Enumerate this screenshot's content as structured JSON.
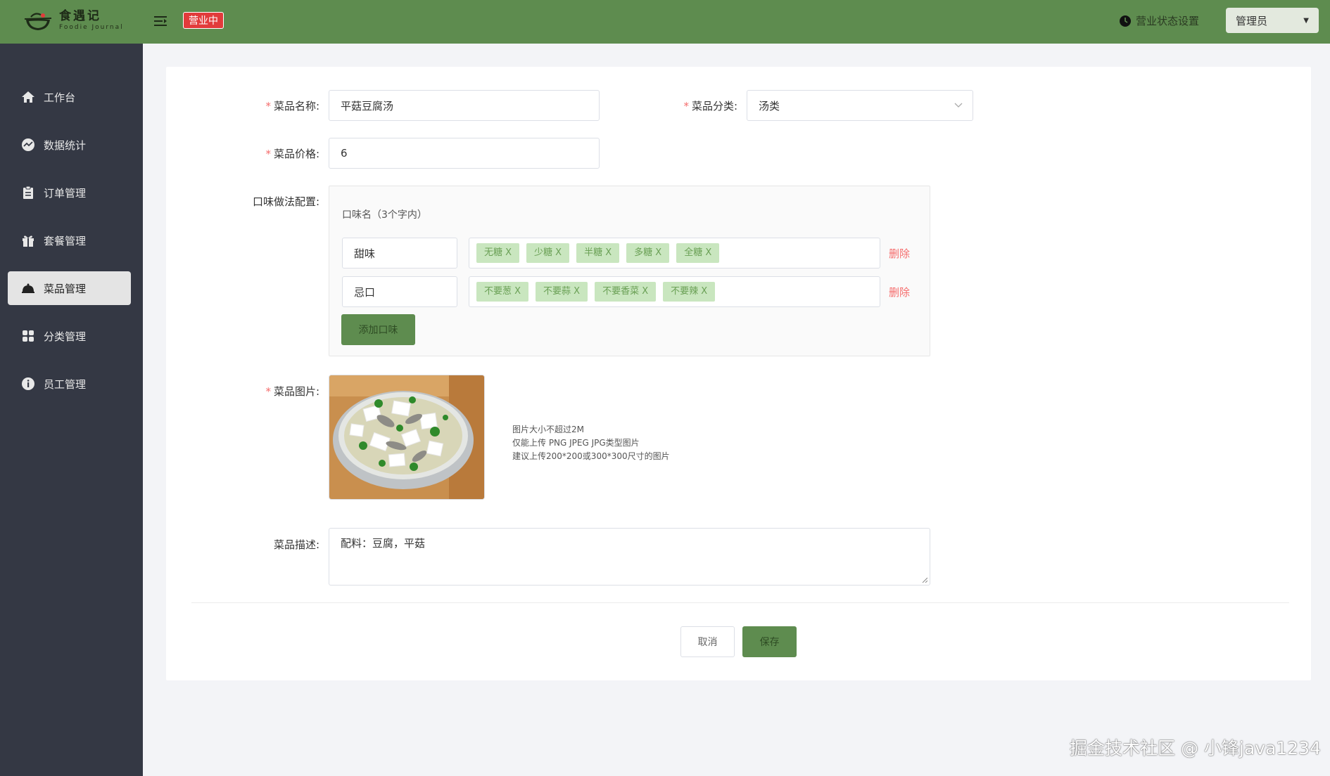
{
  "header": {
    "logo_cn": "食遇记",
    "logo_en": "Foodie Journal",
    "business_badge": "营业中",
    "status_setting": "营业状态设置",
    "admin_label": "管理员",
    "admin_caret": "▼",
    "brand_color": "#5e8c4f"
  },
  "sidebar": {
    "items": [
      {
        "label": "工作台",
        "icon": "home-icon"
      },
      {
        "label": "数据统计",
        "icon": "chart-icon"
      },
      {
        "label": "订单管理",
        "icon": "clipboard-icon"
      },
      {
        "label": "套餐管理",
        "icon": "gift-icon"
      },
      {
        "label": "菜品管理",
        "icon": "cloche-icon",
        "active": true
      },
      {
        "label": "分类管理",
        "icon": "grid-icon"
      },
      {
        "label": "员工管理",
        "icon": "info-icon"
      }
    ]
  },
  "form": {
    "name_label": "菜品名称:",
    "name_value": "平菇豆腐汤",
    "category_label": "菜品分类:",
    "category_value": "汤类",
    "price_label": "菜品价格:",
    "price_value": "6",
    "flavor_label": "口味做法配置:",
    "flavor_hint": "口味名（3个字内）",
    "flavors": [
      {
        "name": "甜味",
        "tags": [
          "无糖 X",
          "少糖 X",
          "半糖 X",
          "多糖 X",
          "全糖 X"
        ],
        "delete": "删除"
      },
      {
        "name": "忌口",
        "tags": [
          "不要葱 X",
          "不要蒜 X",
          "不要香菜 X",
          "不要辣 X"
        ],
        "delete": "删除"
      }
    ],
    "add_flavor": "添加口味",
    "image_label": "菜品图片:",
    "image_hints": [
      "图片大小不超过2M",
      "仅能上传 PNG JPEG JPG类型图片",
      "建议上传200*200或300*300尺寸的图片"
    ],
    "desc_label": "菜品描述:",
    "desc_value": "配料：豆腐，平菇",
    "required_mark": "*",
    "cancel": "取消",
    "save": "保存"
  },
  "watermark": "掘金技术社区 @ 小锋java1234"
}
